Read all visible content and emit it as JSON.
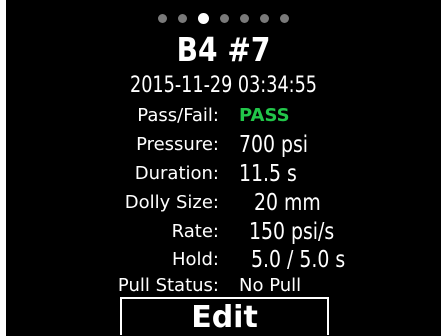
{
  "pagination": {
    "total": 7,
    "active_index": 2
  },
  "title": "B4 #7",
  "timestamp": "2015-11-29 03:34:55",
  "fields": [
    {
      "label": "Pass/Fail:",
      "value": "PASS"
    },
    {
      "label": "Pressure:",
      "value": "700 psi"
    },
    {
      "label": "Duration:",
      "value": "11.5 s"
    },
    {
      "label": "Dolly Size:",
      "value": "20 mm"
    },
    {
      "label": "Rate:",
      "value": "150 psi/s"
    },
    {
      "label": "Hold:",
      "value": "5.0 / 5.0 s"
    },
    {
      "label": "Pull Status:",
      "value": "No Pull"
    }
  ],
  "edit_button": {
    "label": "Edit"
  },
  "colors": {
    "background": "#000000",
    "text": "#ffffff",
    "pass": "#22c64a",
    "inactive_dot": "#7a7a7a"
  }
}
